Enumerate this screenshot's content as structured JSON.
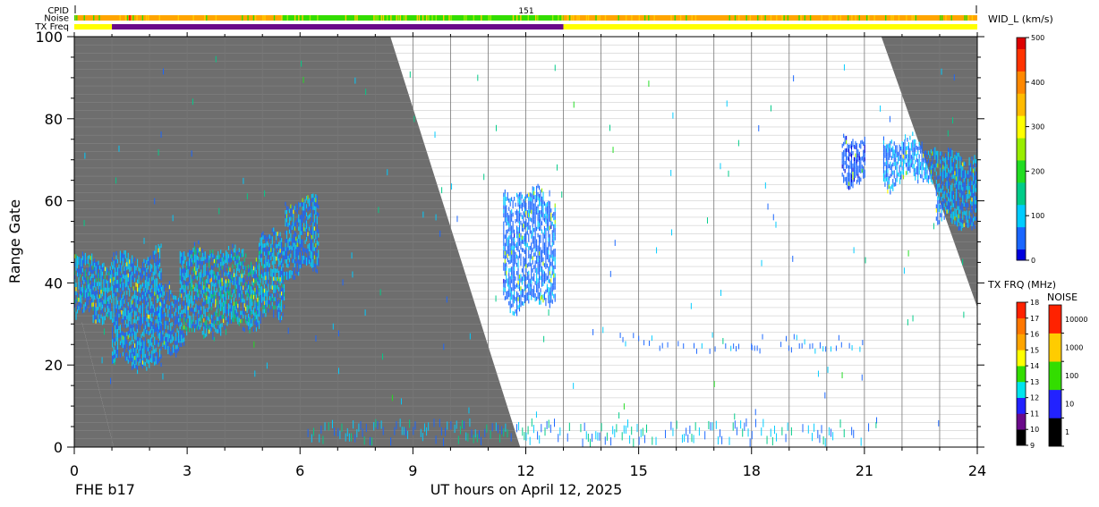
{
  "chart_data": {
    "type": "heatmap",
    "xlabel": "UT hours on April 12, 2025",
    "ylabel": "Range Gate",
    "footer_label": "FHE b17",
    "xlim": [
      0,
      24
    ],
    "ylim": [
      0,
      100
    ],
    "x_ticks": [
      0,
      3,
      6,
      9,
      12,
      15,
      18,
      21,
      24
    ],
    "y_ticks": [
      0,
      20,
      40,
      60,
      80,
      100
    ],
    "ground_scatter_color": "#6e6e6e",
    "strips": {
      "cpid_label": "CPID",
      "cpid_value": "151",
      "noise_label": "Noise",
      "txfreq_label": "TX Freq",
      "cpid_change_hours": [
        0,
        24
      ],
      "noise_segments": [
        {
          "start": 0,
          "end": 5.5,
          "level": "high",
          "color": "#ffa500"
        },
        {
          "start": 5.5,
          "end": 13.0,
          "level": "mid",
          "color": "#33dd00"
        },
        {
          "start": 13.0,
          "end": 24,
          "level": "high",
          "color": "#ffa500"
        }
      ],
      "txfreq_segments": [
        {
          "start": 0,
          "end": 1.0,
          "mhz": 14.2,
          "color": "#ffff00"
        },
        {
          "start": 1.0,
          "end": 13.0,
          "mhz": 10.5,
          "color": "#6a0a8a"
        },
        {
          "start": 13.0,
          "end": 24,
          "mhz": 14.2,
          "color": "#ffff00"
        }
      ]
    },
    "colorbars": [
      {
        "title": "WID_L (km/s)",
        "ticks": [
          0,
          100,
          200,
          300,
          400,
          500
        ],
        "stops": [
          "#0000dd",
          "#1a66ff",
          "#00ccff",
          "#00cc88",
          "#22dd22",
          "#99ee00",
          "#ffff00",
          "#ffbb00",
          "#ff8800",
          "#ff3300",
          "#dd0000"
        ]
      },
      {
        "title": "TX FRQ (MHz)",
        "ticks": [
          9,
          10,
          11,
          12,
          13,
          14,
          15,
          16,
          17,
          18
        ],
        "blocks": [
          "#000000",
          "#6a0a8a",
          "#2222ff",
          "#00e5ee",
          "#33dd00",
          "#ffff00",
          "#ffa500",
          "#ff7700",
          "#ff2200"
        ]
      },
      {
        "title": "NOISE",
        "ticks": [
          1,
          10,
          100,
          1000,
          10000
        ],
        "blocks": [
          "#000000",
          "#2222ff",
          "#33dd00",
          "#ffcc00",
          "#ff2200"
        ]
      }
    ],
    "ground_scatter_regions": [
      {
        "description": "ground",
        "polygon": [
          [
            0,
            0
          ],
          [
            0,
            30.5
          ],
          [
            0.2,
            30.5
          ],
          [
            1.05,
            0
          ]
        ]
      },
      {
        "description": "ground",
        "polygon": [
          [
            0,
            30.5
          ],
          [
            0,
            100
          ],
          [
            8.4,
            100
          ],
          [
            11.85,
            0
          ],
          [
            1.05,
            0
          ],
          [
            0.2,
            30.5
          ]
        ]
      },
      {
        "description": "ground",
        "polygon": [
          [
            21.45,
            100
          ],
          [
            24,
            100
          ],
          [
            24,
            34
          ]
        ]
      }
    ],
    "ionospheric_scatter": [
      {
        "t0": 0.0,
        "t1": 1.0,
        "g_lo": 30,
        "g_hi": 47,
        "width": 120
      },
      {
        "t0": 1.0,
        "t1": 2.3,
        "g_lo": 19,
        "g_hi": 47,
        "width": 110
      },
      {
        "t0": 2.2,
        "t1": 2.8,
        "g_lo": 22,
        "g_hi": 40,
        "width": 100
      },
      {
        "t0": 2.8,
        "t1": 3.6,
        "g_lo": 26,
        "g_hi": 48,
        "width": 130
      },
      {
        "t0": 3.6,
        "t1": 4.9,
        "g_lo": 28,
        "g_hi": 48,
        "width": 140
      },
      {
        "t0": 4.9,
        "t1": 5.6,
        "g_lo": 30,
        "g_hi": 52,
        "width": 120
      },
      {
        "t0": 5.6,
        "t1": 6.5,
        "g_lo": 42,
        "g_hi": 60,
        "width": 100
      },
      {
        "t0": 11.4,
        "t1": 12.8,
        "g_lo": 34,
        "g_hi": 62,
        "width": 80
      },
      {
        "t0": 20.4,
        "t1": 21.0,
        "g_lo": 64,
        "g_hi": 76,
        "width": 60
      },
      {
        "t0": 21.5,
        "t1": 22.9,
        "g_lo": 64,
        "g_hi": 75,
        "width": 90
      },
      {
        "t0": 22.9,
        "t1": 24.0,
        "g_lo": 53,
        "g_hi": 72,
        "width": 110
      }
    ]
  }
}
